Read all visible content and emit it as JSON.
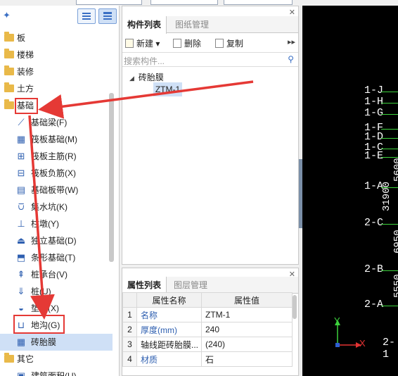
{
  "left_panel": {
    "tree": [
      {
        "type": "folder",
        "label": "板"
      },
      {
        "type": "folder",
        "label": "楼梯"
      },
      {
        "type": "folder",
        "label": "装修"
      },
      {
        "type": "folder",
        "label": "土方"
      },
      {
        "type": "folder",
        "label": "基础",
        "highlighted": true
      },
      {
        "type": "child",
        "label": "基础梁(F)",
        "icon": "beam-icon"
      },
      {
        "type": "child",
        "label": "筏板基础(M)",
        "icon": "raft-icon"
      },
      {
        "type": "child",
        "label": "筏板主筋(R)",
        "icon": "rebar-icon"
      },
      {
        "type": "child",
        "label": "筏板负筋(X)",
        "icon": "neg-rebar-icon"
      },
      {
        "type": "child",
        "label": "基础板带(W)",
        "icon": "strip-icon"
      },
      {
        "type": "child",
        "label": "集水坑(K)",
        "icon": "sump-icon"
      },
      {
        "type": "child",
        "label": "柱墩(Y)",
        "icon": "pier-icon"
      },
      {
        "type": "child",
        "label": "独立基础(D)",
        "icon": "footing-icon"
      },
      {
        "type": "child",
        "label": "条形基础(T)",
        "icon": "strip-footing-icon"
      },
      {
        "type": "child",
        "label": "桩承台(V)",
        "icon": "pile-cap-icon"
      },
      {
        "type": "child",
        "label": "桩(U)",
        "icon": "pile-icon"
      },
      {
        "type": "child",
        "label": "垫层(X)",
        "icon": "cushion-icon"
      },
      {
        "type": "child",
        "label": "地沟(G)",
        "icon": "trench-icon",
        "highlighted": true
      },
      {
        "type": "child",
        "label": "砖胎膜",
        "icon": "brick-mold-icon",
        "selected": true
      },
      {
        "type": "folder",
        "label": "其它"
      },
      {
        "type": "child",
        "label": "建筑面积(U)",
        "icon": "area-icon"
      }
    ]
  },
  "component_panel": {
    "tabs": [
      "构件列表",
      "图纸管理"
    ],
    "actions": {
      "new": "新建",
      "delete": "删除",
      "copy": "复制"
    },
    "search_placeholder": "搜索构件...",
    "group": "砖胎膜",
    "item": "ZTM-1"
  },
  "property_panel": {
    "tabs": [
      "属性列表",
      "图层管理"
    ],
    "headers": [
      "属性名称",
      "属性值"
    ],
    "rows": [
      {
        "n": "1",
        "name": "名称",
        "value": "ZTM-1",
        "blue": true
      },
      {
        "n": "2",
        "name": "厚度(mm)",
        "value": "240",
        "blue": true
      },
      {
        "n": "3",
        "name": "轴线距砖胎膜...",
        "value": "(240)",
        "blue": false
      },
      {
        "n": "4",
        "name": "材质",
        "value": "石",
        "blue": true
      }
    ]
  },
  "cad": {
    "axis_labels": [
      "1-J",
      "1-H",
      "1-G",
      "1-F",
      "1-D",
      "1-C",
      "1-E",
      "1-A",
      "2-C",
      "2-B",
      "2-A",
      "2-1"
    ],
    "dimensions": [
      "31900",
      "5600",
      "6950",
      "5550"
    ],
    "ucs_x": "X",
    "ucs_y": "Y",
    "line_color": "#3cd13c"
  },
  "colors": {
    "annotation_red": "#e53935",
    "accent_blue": "#3a6fc4"
  }
}
